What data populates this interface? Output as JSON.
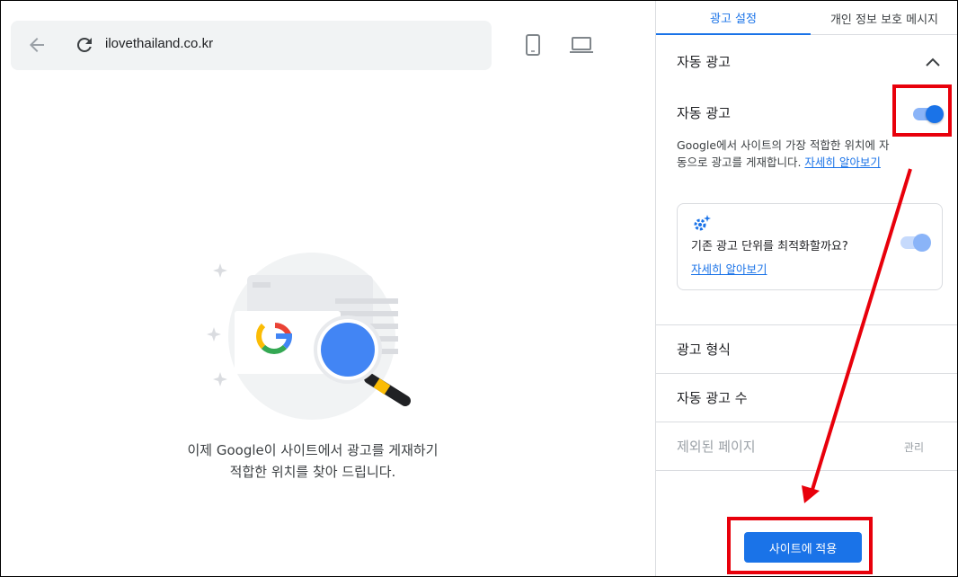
{
  "preview": {
    "url": "ilovethailand.co.kr",
    "hint_line1": "이제 Google이 사이트에서 광고를 게재하기",
    "hint_line2": "적합한 위치를 찾아 드립니다.",
    "icons": [
      "back-arrow-icon",
      "reload-icon",
      "mobile-device-icon",
      "desktop-device-icon"
    ]
  },
  "panel": {
    "tabs": [
      {
        "label": "광고 설정",
        "active": true
      },
      {
        "label": "개인 정보 보호 메시지",
        "active": false
      }
    ],
    "section_title": "자동 광고",
    "auto_ads": {
      "label": "자동 광고",
      "enabled": true,
      "description": "Google에서 사이트의 가장 적합한 위치에 자동으로 광고를 게재합니다.",
      "learn_more": "자세히 알아보기"
    },
    "optimize_card": {
      "question": "기존 광고 단위를 최적화할까요?",
      "learn_more": "자세히 알아보기",
      "enabled": true
    },
    "rows": [
      {
        "label": "광고 형식"
      },
      {
        "label": "자동 광고 수"
      },
      {
        "label": "제외된 페이지",
        "action": "관리",
        "disabled": true
      }
    ],
    "apply_button": "사이트에 적용"
  },
  "colors": {
    "accent": "#1a73e8",
    "annotation": "#e8000b"
  }
}
